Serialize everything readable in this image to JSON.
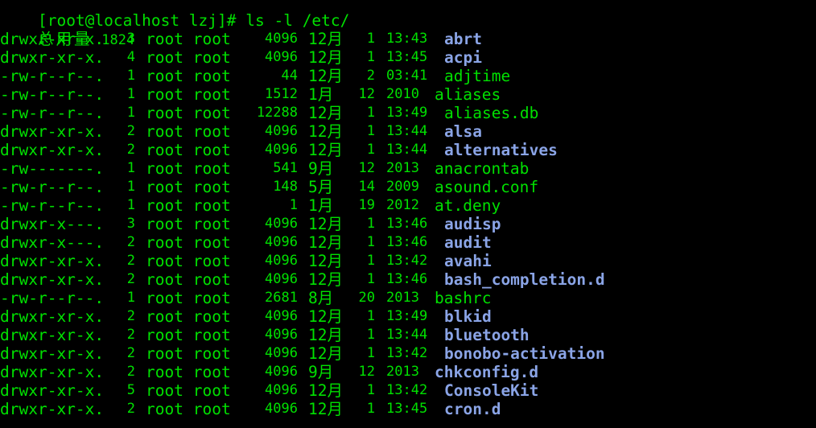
{
  "terminal": {
    "prompt": "[root@localhost lzj]# ",
    "command": "ls -l /etc/",
    "total_label": "总用量",
    "total_value": "1824",
    "colors": {
      "background": "#000000",
      "text": "#00e000",
      "directory": "#8aa4e6"
    },
    "entries": [
      {
        "perm": "drwxr-xr-x.",
        "links": "3",
        "owner": "root",
        "group": "root",
        "size": "4096",
        "month": "12月",
        "day": "1",
        "time": "13:43",
        "name": "abrt",
        "type": "dir"
      },
      {
        "perm": "drwxr-xr-x.",
        "links": "4",
        "owner": "root",
        "group": "root",
        "size": "4096",
        "month": "12月",
        "day": "1",
        "time": "13:45",
        "name": "acpi",
        "type": "dir"
      },
      {
        "perm": "-rw-r--r--.",
        "links": "1",
        "owner": "root",
        "group": "root",
        "size": "44",
        "month": "12月",
        "day": "2",
        "time": "03:41",
        "name": "adjtime",
        "type": "file"
      },
      {
        "perm": "-rw-r--r--.",
        "links": "1",
        "owner": "root",
        "group": "root",
        "size": "1512",
        "month": "1月",
        "day": "12",
        "time": "2010",
        "name": "aliases",
        "type": "file"
      },
      {
        "perm": "-rw-r--r--.",
        "links": "1",
        "owner": "root",
        "group": "root",
        "size": "12288",
        "month": "12月",
        "day": "1",
        "time": "13:49",
        "name": "aliases.db",
        "type": "file"
      },
      {
        "perm": "drwxr-xr-x.",
        "links": "2",
        "owner": "root",
        "group": "root",
        "size": "4096",
        "month": "12月",
        "day": "1",
        "time": "13:44",
        "name": "alsa",
        "type": "dir"
      },
      {
        "perm": "drwxr-xr-x.",
        "links": "2",
        "owner": "root",
        "group": "root",
        "size": "4096",
        "month": "12月",
        "day": "1",
        "time": "13:44",
        "name": "alternatives",
        "type": "dir"
      },
      {
        "perm": "-rw-------.",
        "links": "1",
        "owner": "root",
        "group": "root",
        "size": "541",
        "month": "9月",
        "day": "12",
        "time": "2013",
        "name": "anacrontab",
        "type": "file"
      },
      {
        "perm": "-rw-r--r--.",
        "links": "1",
        "owner": "root",
        "group": "root",
        "size": "148",
        "month": "5月",
        "day": "14",
        "time": "2009",
        "name": "asound.conf",
        "type": "file"
      },
      {
        "perm": "-rw-r--r--.",
        "links": "1",
        "owner": "root",
        "group": "root",
        "size": "1",
        "month": "1月",
        "day": "19",
        "time": "2012",
        "name": "at.deny",
        "type": "file"
      },
      {
        "perm": "drwxr-x---.",
        "links": "3",
        "owner": "root",
        "group": "root",
        "size": "4096",
        "month": "12月",
        "day": "1",
        "time": "13:46",
        "name": "audisp",
        "type": "dir"
      },
      {
        "perm": "drwxr-x---.",
        "links": "2",
        "owner": "root",
        "group": "root",
        "size": "4096",
        "month": "12月",
        "day": "1",
        "time": "13:46",
        "name": "audit",
        "type": "dir"
      },
      {
        "perm": "drwxr-xr-x.",
        "links": "2",
        "owner": "root",
        "group": "root",
        "size": "4096",
        "month": "12月",
        "day": "1",
        "time": "13:42",
        "name": "avahi",
        "type": "dir"
      },
      {
        "perm": "drwxr-xr-x.",
        "links": "2",
        "owner": "root",
        "group": "root",
        "size": "4096",
        "month": "12月",
        "day": "1",
        "time": "13:46",
        "name": "bash_completion.d",
        "type": "dir"
      },
      {
        "perm": "-rw-r--r--.",
        "links": "1",
        "owner": "root",
        "group": "root",
        "size": "2681",
        "month": "8月",
        "day": "20",
        "time": "2013",
        "name": "bashrc",
        "type": "file"
      },
      {
        "perm": "drwxr-xr-x.",
        "links": "2",
        "owner": "root",
        "group": "root",
        "size": "4096",
        "month": "12月",
        "day": "1",
        "time": "13:49",
        "name": "blkid",
        "type": "dir"
      },
      {
        "perm": "drwxr-xr-x.",
        "links": "2",
        "owner": "root",
        "group": "root",
        "size": "4096",
        "month": "12月",
        "day": "1",
        "time": "13:44",
        "name": "bluetooth",
        "type": "dir"
      },
      {
        "perm": "drwxr-xr-x.",
        "links": "2",
        "owner": "root",
        "group": "root",
        "size": "4096",
        "month": "12月",
        "day": "1",
        "time": "13:42",
        "name": "bonobo-activation",
        "type": "dir"
      },
      {
        "perm": "drwxr-xr-x.",
        "links": "2",
        "owner": "root",
        "group": "root",
        "size": "4096",
        "month": "9月",
        "day": "12",
        "time": "2013",
        "name": "chkconfig.d",
        "type": "dir-plain"
      },
      {
        "perm": "drwxr-xr-x.",
        "links": "5",
        "owner": "root",
        "group": "root",
        "size": "4096",
        "month": "12月",
        "day": "1",
        "time": "13:42",
        "name": "ConsoleKit",
        "type": "dir"
      },
      {
        "perm": "drwxr-xr-x.",
        "links": "2",
        "owner": "root",
        "group": "root",
        "size": "4096",
        "month": "12月",
        "day": "1",
        "time": "13:45",
        "name": "cron.d",
        "type": "dir"
      }
    ]
  }
}
